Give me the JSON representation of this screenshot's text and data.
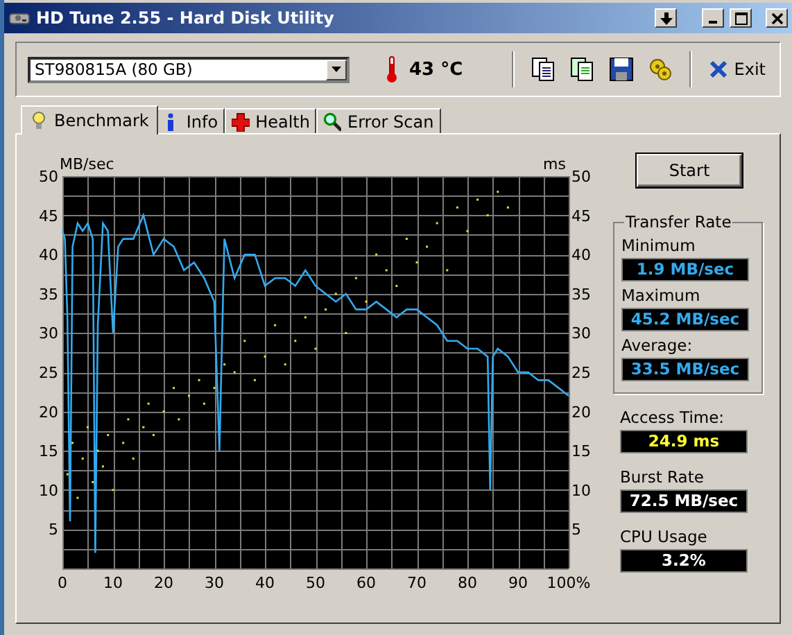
{
  "window": {
    "title": "HD Tune 2.55 - Hard Disk Utility"
  },
  "toolbar": {
    "drive": "ST980815A (80 GB)",
    "temperature": "43 °C",
    "exit": "Exit"
  },
  "tabs": [
    {
      "label": "Benchmark",
      "selected": true
    },
    {
      "label": "Info",
      "selected": false
    },
    {
      "label": "Health",
      "selected": false
    },
    {
      "label": "Error Scan",
      "selected": false
    }
  ],
  "benchmark": {
    "transfer_chart": {
      "chart_data": {
        "type": "line",
        "ylabel": "MB/sec",
        "xlim": [
          0,
          100
        ],
        "ylim": [
          0,
          50
        ],
        "xticks": [
          0,
          10,
          20,
          30,
          40,
          50,
          60,
          70,
          80,
          90,
          {
            "value": 100,
            "label": "100%"
          }
        ],
        "yticks": [
          5,
          10,
          15,
          20,
          25,
          30,
          35,
          40,
          45,
          50
        ],
        "x": [
          0,
          0.5,
          1,
          1.5,
          2,
          3,
          4,
          5,
          6,
          6.5,
          7,
          8,
          9,
          10,
          11,
          12,
          14,
          16,
          18,
          20,
          22,
          24,
          26,
          28,
          30,
          31,
          32,
          34,
          36,
          38,
          40,
          42,
          44,
          46,
          48,
          50,
          52,
          54,
          56,
          58,
          60,
          62,
          64,
          66,
          68,
          70,
          72,
          74,
          76,
          78,
          80,
          82,
          84,
          84.5,
          85,
          86,
          88,
          90,
          92,
          94,
          96,
          98,
          100
        ],
        "series": [
          {
            "color": "#33aaee",
            "values": [
              43,
              42,
              32,
              6,
              41,
              44,
              43,
              44,
              42,
              2,
              31,
              44,
              43,
              30,
              41,
              42,
              42,
              45,
              40,
              42,
              41,
              38,
              39,
              37,
              34,
              15,
              42,
              37,
              40,
              40,
              36,
              37,
              37,
              36,
              38,
              36,
              35,
              34,
              35,
              33,
              33,
              34,
              33,
              32,
              33,
              33,
              32,
              31,
              29,
              29,
              28,
              28,
              27,
              10,
              27,
              28,
              27,
              25,
              25,
              24,
              24,
              23,
              22
            ]
          }
        ]
      }
    },
    "access_chart": {
      "chart_data": {
        "type": "scatter",
        "ylabel": "ms",
        "xlim": [
          0,
          100
        ],
        "ylim": [
          0,
          50
        ],
        "yticks": [
          5,
          10,
          15,
          20,
          25,
          30,
          35,
          40,
          45,
          50
        ],
        "x": [
          1,
          2,
          3,
          4,
          5,
          6,
          7,
          8,
          9,
          10,
          12,
          13,
          14,
          16,
          17,
          18,
          20,
          22,
          23,
          25,
          27,
          28,
          30,
          32,
          34,
          36,
          38,
          40,
          42,
          44,
          46,
          48,
          50,
          52,
          54,
          56,
          58,
          60,
          62,
          64,
          66,
          68,
          70,
          72,
          74,
          76,
          78,
          80,
          82,
          84,
          86,
          88
        ],
        "series": [
          {
            "color": "#dddd33",
            "values": [
              12,
              16,
              9,
              14,
              18,
              11,
              15,
              13,
              17,
              10,
              16,
              19,
              14,
              18,
              21,
              17,
              20,
              23,
              19,
              22,
              24,
              21,
              23,
              26,
              25,
              29,
              24,
              27,
              31,
              26,
              29,
              32,
              28,
              33,
              35,
              30,
              37,
              34,
              40,
              38,
              36,
              42,
              39,
              41,
              44,
              38,
              46,
              43,
              47,
              45,
              48,
              46
            ]
          }
        ]
      }
    }
  },
  "start_button": "Start",
  "transfer_rate": {
    "title": "Transfer Rate",
    "stats": [
      {
        "label": "Minimum",
        "value": "1.9 MB/sec"
      },
      {
        "label": "Maximum",
        "value": "45.2 MB/sec"
      },
      {
        "label": "Average:",
        "value": "33.5 MB/sec"
      }
    ]
  },
  "other_stats": [
    {
      "label": "Access Time:",
      "value": "24.9 ms",
      "kind": "access"
    },
    {
      "label": "Burst Rate",
      "value": "72.5 MB/sec",
      "kind": "burst"
    },
    {
      "label": "CPU Usage",
      "value": "3.2%",
      "kind": "cpu"
    }
  ]
}
